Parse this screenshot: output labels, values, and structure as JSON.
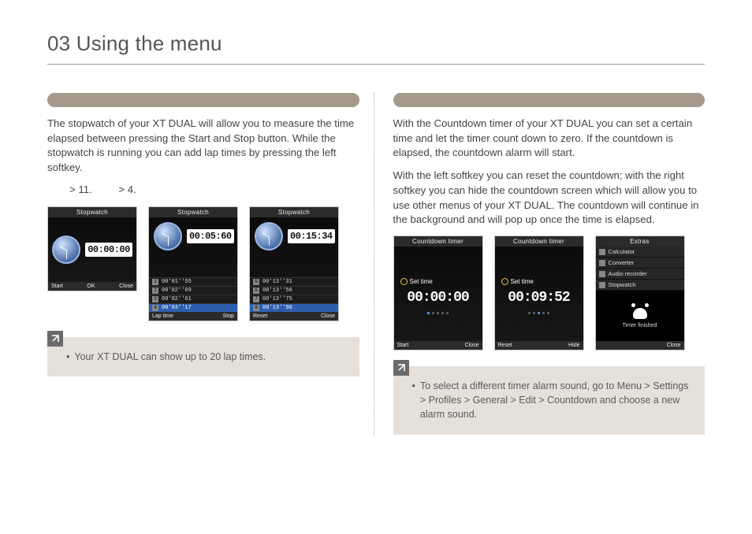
{
  "page": {
    "title": "03 Using the menu"
  },
  "left": {
    "p1": "The stopwatch of your XT DUAL will allow you to measure the time elapsed between pressing the Start and Stop button. While the stopwatch is running you can add lap times by pressing the left softkey.",
    "nav": {
      "gt1": ">",
      "n1": "11.",
      "gt2": ">",
      "n2": "4."
    },
    "screens": {
      "s1": {
        "title": "Stopwatch",
        "time": "00:00:00",
        "foot": {
          "l": "Start",
          "c": "OK",
          "r": "Close"
        }
      },
      "s2": {
        "title": "Stopwatch",
        "time": "00:05:60",
        "laps": [
          {
            "idx": "1",
            "t": "00'01''55"
          },
          {
            "idx": "2",
            "t": "00'02''09"
          },
          {
            "idx": "3",
            "t": "00'02''61"
          },
          {
            "idx": "4",
            "t": "00'03''17",
            "sel": true
          }
        ],
        "foot": {
          "l": "Lap time",
          "c": "",
          "r": "Stop"
        }
      },
      "s3": {
        "title": "Stopwatch",
        "time": "00:15:34",
        "laps": [
          {
            "idx": "5",
            "t": "00'13''31"
          },
          {
            "idx": "6",
            "t": "00'13''56"
          },
          {
            "idx": "7",
            "t": "00'13''75"
          },
          {
            "idx": "8",
            "t": "00'13''96",
            "sel": true
          }
        ],
        "foot": {
          "l": "Reset",
          "c": "",
          "r": "Close"
        }
      }
    },
    "tip": "Your XT DUAL can show up to 20 lap times."
  },
  "right": {
    "p1": "With the Countdown timer of your XT DUAL you can set a certain time and let the timer count down to zero. If the countdown is elapsed, the countdown alarm will start.",
    "p2": "With the left softkey you can reset the countdown; with the right softkey you can hide the countdown screen which will allow you to use other menus of your XT DUAL. The countdown will continue in the background and will pop up once the time is elapsed.",
    "screens": {
      "c1": {
        "title": "Countdown timer",
        "set": "Set time",
        "time": "00:00:00",
        "foot": {
          "l": "Start",
          "r": "Close"
        }
      },
      "c2": {
        "title": "Countdown timer",
        "set": "Set time",
        "time": "00:09:52",
        "foot": {
          "l": "Reset",
          "r": "Hide"
        }
      },
      "c3": {
        "title": "Extras",
        "items": [
          "Calculator",
          "Converter",
          "Audio recorder",
          "Stopwatch"
        ],
        "finished": "Timer finished",
        "foot": {
          "l": "",
          "r": "Close"
        }
      }
    },
    "tip": "To select a different timer alarm sound, go to Menu > Settings > Profiles > General > Edit > Countdown and choose a new alarm sound."
  }
}
